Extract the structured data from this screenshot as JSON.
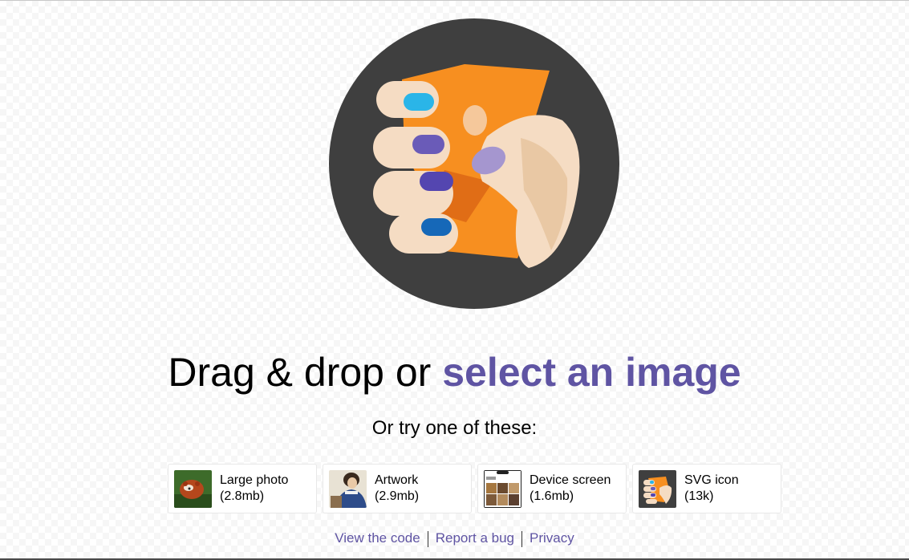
{
  "headline": {
    "prefix": "Drag & drop or ",
    "link": "select an image"
  },
  "subhead": "Or try one of these:",
  "demos": [
    {
      "title": "Large photo",
      "size": "(2.8mb)",
      "icon": "red-panda-photo-thumbnail"
    },
    {
      "title": "Artwork",
      "size": "(2.9mb)",
      "icon": "painting-artwork-thumbnail"
    },
    {
      "title": "Device screen",
      "size": "(1.6mb)",
      "icon": "phone-screenshot-thumbnail"
    },
    {
      "title": "SVG icon",
      "size": "(13k)",
      "icon": "hand-logo-thumbnail"
    }
  ],
  "footer": {
    "links": [
      "View the code",
      "Report a bug",
      "Privacy"
    ]
  },
  "colors": {
    "accent": "#5f54a3",
    "logo_circle": "#3f3f3f",
    "logo_orange": "#f78f20"
  }
}
